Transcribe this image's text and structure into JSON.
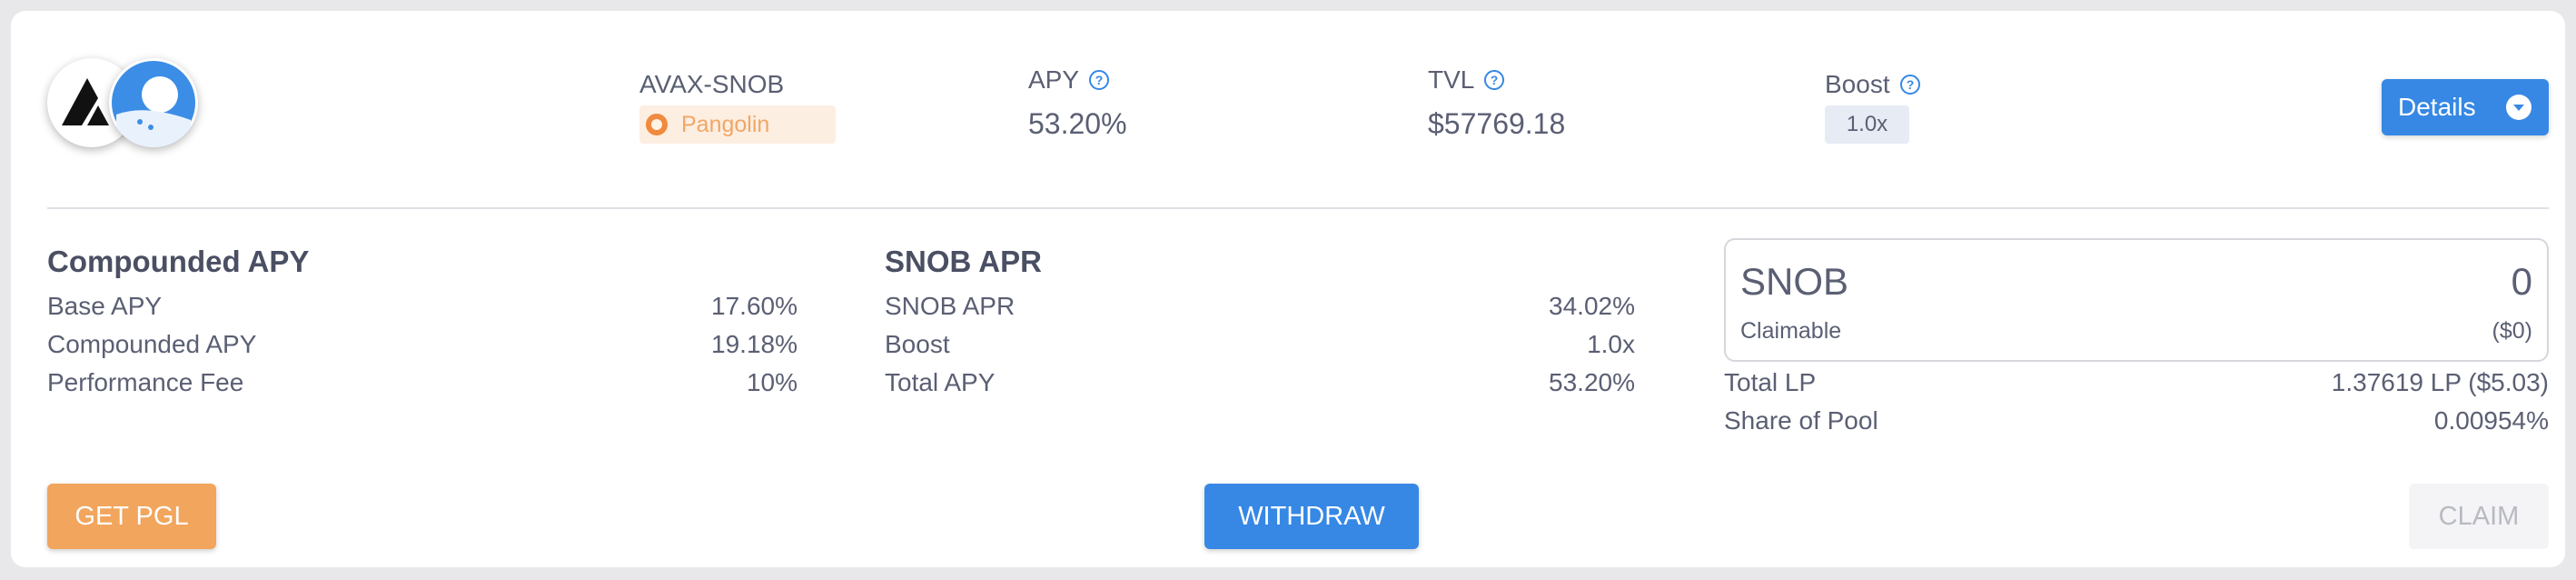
{
  "pool": {
    "pair": "AVAX-SNOB",
    "platform": "Pangolin",
    "logos": [
      "avalanche-logo",
      "snowball-logo"
    ]
  },
  "stats": {
    "apy_label": "APY",
    "apy_value": "53.20%",
    "tvl_label": "TVL",
    "tvl_value": "$57769.18",
    "boost_label": "Boost",
    "boost_value": "1.0x"
  },
  "details_button": "Details",
  "compounded": {
    "title": "Compounded APY",
    "rows": [
      {
        "label": "Base APY",
        "value": "17.60%"
      },
      {
        "label": "Compounded APY",
        "value": "19.18%"
      },
      {
        "label": "Performance Fee",
        "value": "10%"
      }
    ]
  },
  "snob_apr": {
    "title": "SNOB APR",
    "rows": [
      {
        "label": "SNOB APR",
        "value": "34.02%"
      },
      {
        "label": "Boost",
        "value": "1.0x"
      },
      {
        "label": "Total APY",
        "value": "53.20%"
      }
    ]
  },
  "claim": {
    "token": "SNOB",
    "amount": "0",
    "label": "Claimable",
    "usd": "($0)"
  },
  "position": {
    "rows": [
      {
        "label": "Total LP",
        "value": "1.37619 LP ($5.03)"
      },
      {
        "label": "Share of Pool",
        "value": "0.00954%"
      }
    ]
  },
  "buttons": {
    "get_pgl": "GET PGL",
    "withdraw": "WITHDRAW",
    "claim": "CLAIM"
  },
  "colors": {
    "primary": "#3688e4",
    "orange": "#f2a55c",
    "pangolin_bg": "#fdeee2",
    "text": "#5a5f73"
  }
}
